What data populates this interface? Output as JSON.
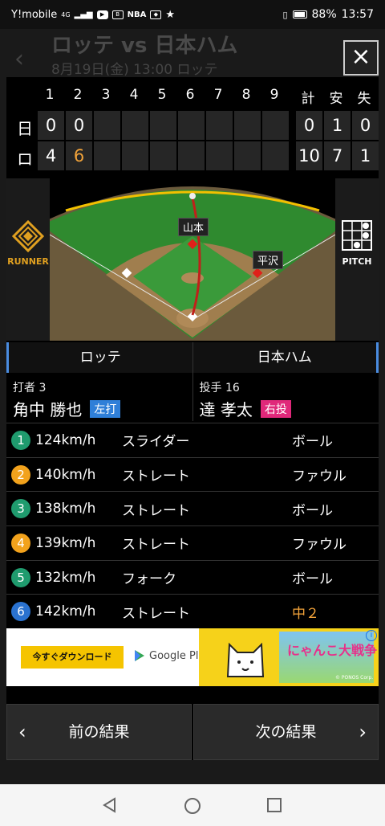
{
  "status_bar": {
    "carrier": "Y!mobile",
    "network": "4G",
    "nba": "NBA",
    "battery": "88%",
    "time": "13:57"
  },
  "background": {
    "title": "ロッテ vs 日本ハム",
    "subtitle": "8月19日(金) 13:00 ロッテ"
  },
  "close_label": "×",
  "scoreboard": {
    "innings": [
      "1",
      "2",
      "3",
      "4",
      "5",
      "6",
      "7",
      "8",
      "9"
    ],
    "totals_headers": [
      "計",
      "安",
      "失"
    ],
    "rows": [
      {
        "team": "日",
        "scores": [
          "0",
          "0",
          "",
          "",
          "",
          "",
          "",
          "",
          ""
        ],
        "totals": [
          "0",
          "1",
          "0"
        ]
      },
      {
        "team": "ロ",
        "scores": [
          "4",
          "6",
          "",
          "",
          "",
          "",
          "",
          "",
          ""
        ],
        "totals": [
          "10",
          "7",
          "1"
        ]
      }
    ]
  },
  "field": {
    "runner_label": "RUNNER",
    "pitch_label": "PITCH",
    "runners": [
      "山本",
      "平沢"
    ]
  },
  "tabs": [
    "ロッテ",
    "日本ハム"
  ],
  "batter": {
    "role": "打者 3",
    "name": "角中 勝也",
    "badge": "左打"
  },
  "pitcher": {
    "role": "投手 16",
    "name": "達 孝太",
    "badge": "右投"
  },
  "pitches": [
    {
      "num": "1",
      "color": "#1f9b6e",
      "speed": "124km/h",
      "type": "スライダー",
      "result": "ボール",
      "highlight": false
    },
    {
      "num": "2",
      "color": "#f2a21c",
      "speed": "140km/h",
      "type": "ストレート",
      "result": "ファウル",
      "highlight": false
    },
    {
      "num": "3",
      "color": "#1f9b6e",
      "speed": "138km/h",
      "type": "ストレート",
      "result": "ボール",
      "highlight": false
    },
    {
      "num": "4",
      "color": "#f2a21c",
      "speed": "139km/h",
      "type": "ストレート",
      "result": "ファウル",
      "highlight": false
    },
    {
      "num": "5",
      "color": "#1f9b6e",
      "speed": "132km/h",
      "type": "フォーク",
      "result": "ボール",
      "highlight": false
    },
    {
      "num": "6",
      "color": "#2a72d0",
      "speed": "142km/h",
      "type": "ストレート",
      "result": "中２",
      "highlight": true
    }
  ],
  "ad": {
    "cta": "今すぐダウンロード",
    "store": "Google Play",
    "logo": "にゃんこ大戦争",
    "corp": "© PONOS Corp."
  },
  "nav": {
    "prev": "前の結果",
    "next": "次の結果"
  }
}
